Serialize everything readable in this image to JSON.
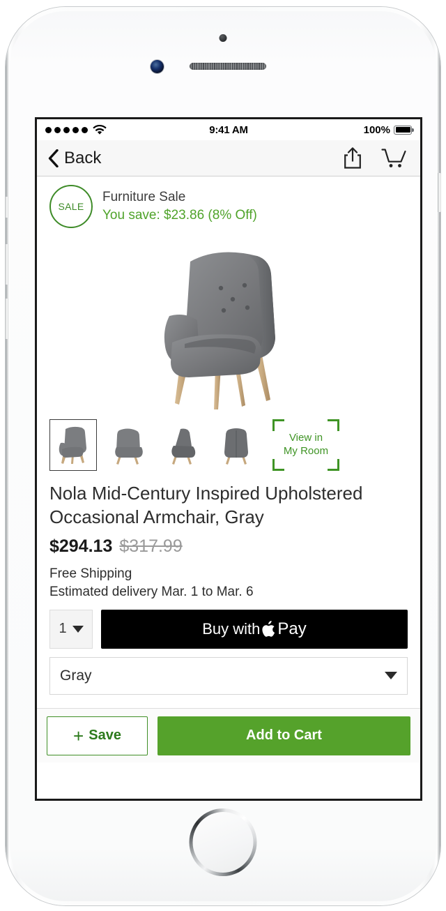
{
  "device": {
    "sensor_icon": "proximity-sensor",
    "camera_icon": "front-camera",
    "speaker_icon": "earpiece-speaker",
    "home_icon": "home-button"
  },
  "status_bar": {
    "signal_dots": 5,
    "wifi_icon": "wifi-icon",
    "time": "9:41 AM",
    "battery_percent": "100%",
    "battery_icon": "battery-full-icon"
  },
  "nav_bar": {
    "back_label": "Back",
    "back_icon": "chevron-left-icon",
    "share_icon": "share-icon",
    "cart_icon": "shopping-cart-icon"
  },
  "sale_banner": {
    "badge_text": "SALE",
    "title": "Furniture Sale",
    "savings": "You save: $23.86 (8% Off)",
    "badge_color": "#3e8b28",
    "savings_color": "#4fa32a"
  },
  "gallery": {
    "thumbnails": [
      {
        "name": "chair-front-angle",
        "selected": true
      },
      {
        "name": "chair-front",
        "selected": false
      },
      {
        "name": "chair-side",
        "selected": false
      },
      {
        "name": "chair-back",
        "selected": false
      }
    ],
    "ar_tile": {
      "line1": "View in",
      "line2": "My Room",
      "color": "#3f9425"
    }
  },
  "product": {
    "title": "Nola Mid-Century Inspired Upholstered Occasional Armchair, Gray",
    "price_current": "$294.13",
    "price_original": "$317.99",
    "shipping": "Free Shipping",
    "delivery_estimate": "Estimated delivery Mar. 1 to Mar. 6"
  },
  "purchase": {
    "quantity": "1",
    "apple_pay_prefix": "Buy with",
    "apple_pay_brand": "Pay",
    "apple_logo": "apple-logo-icon",
    "color_selected": "Gray"
  },
  "bottom_bar": {
    "save_plus": "+",
    "save_label": "Save",
    "add_to_cart_label": "Add to Cart",
    "save_color": "#2c7a1c",
    "cart_color": "#55a22b"
  }
}
